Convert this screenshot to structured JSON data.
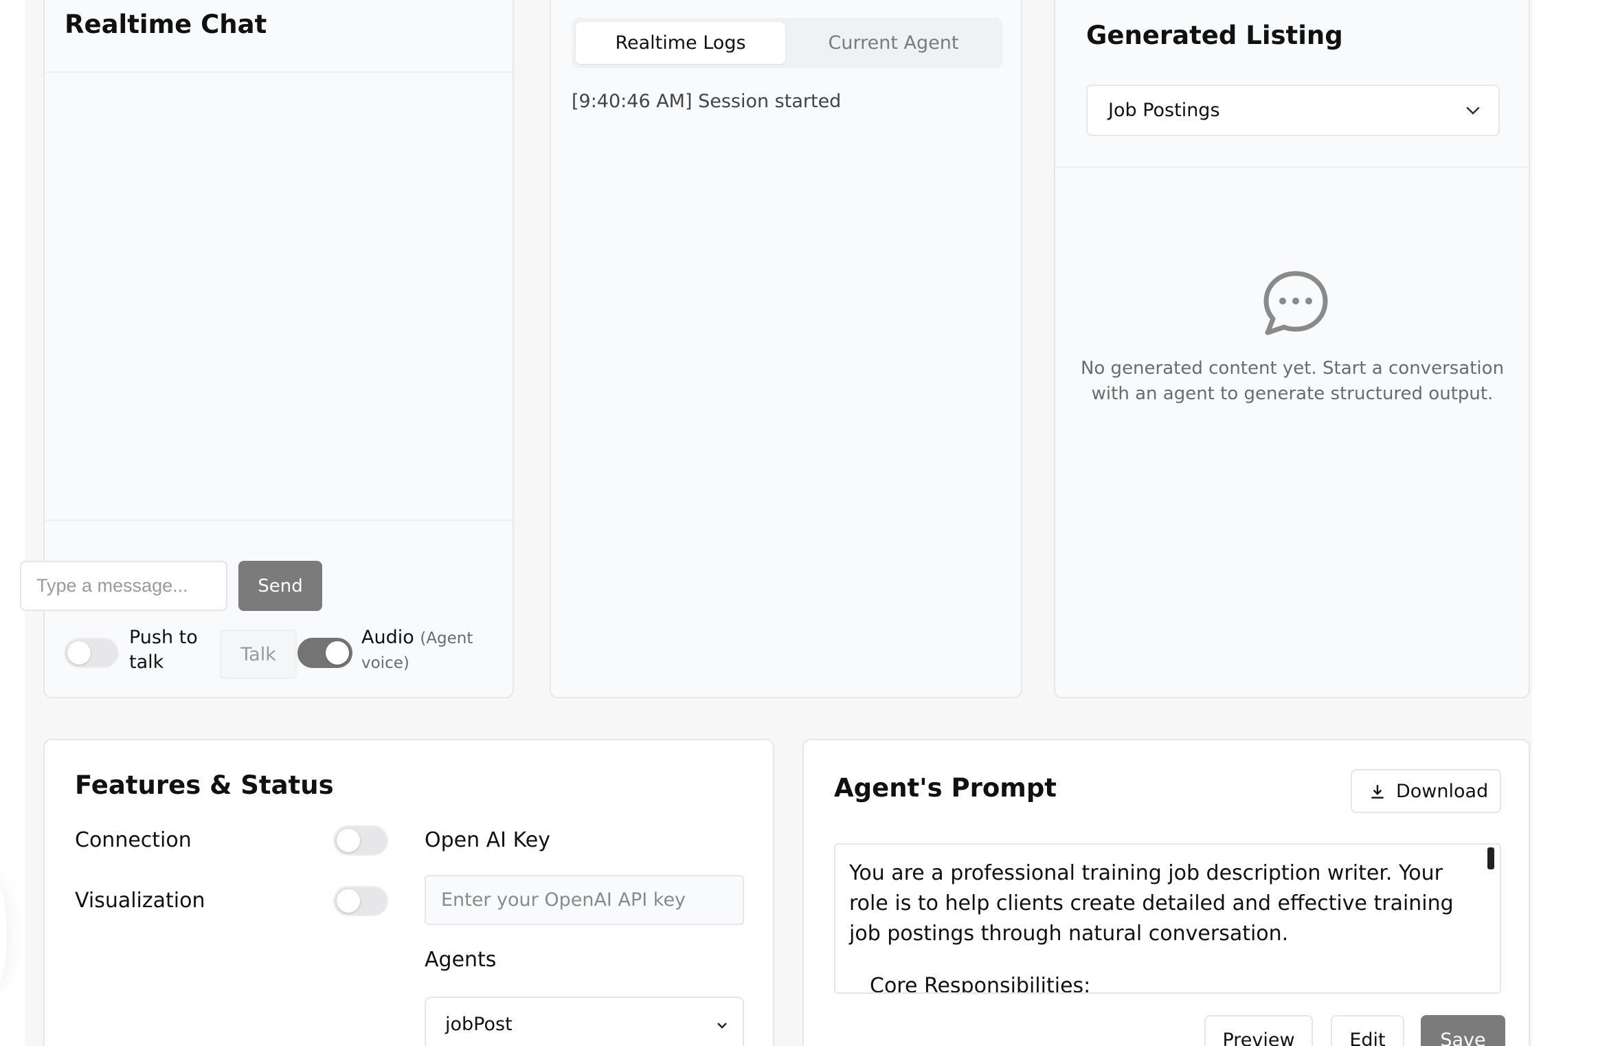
{
  "chat": {
    "title": "Realtime Chat",
    "input_placeholder": "Type a message...",
    "send_label": "Send",
    "push_to_talk_label_1": "Push to",
    "push_to_talk_label_2": "talk",
    "push_to_talk_on": false,
    "talk_label": "Talk",
    "audio_label": "Audio",
    "audio_sub_1": "(Agent",
    "audio_sub_2": "voice)",
    "audio_on": true
  },
  "logs": {
    "tabs": [
      {
        "label": "Realtime Logs",
        "active": true
      },
      {
        "label": "Current Agent",
        "active": false
      }
    ],
    "entries": [
      "[9:40:46 AM] Session started"
    ]
  },
  "listing": {
    "title": "Generated Listing",
    "selected": "Job Postings",
    "empty_line_1": "No generated content yet. Start a conversation",
    "empty_line_2": "with an agent to generate structured output."
  },
  "features": {
    "title": "Features & Status",
    "connection_label": "Connection",
    "connection_on": false,
    "visualization_label": "Visualization",
    "visualization_on": false,
    "api_key_label": "Open AI Key",
    "api_key_placeholder": "Enter your OpenAI API key",
    "agents_label": "Agents",
    "agent_selected": "jobPost"
  },
  "prompt": {
    "title": "Agent's Prompt",
    "download_label": "Download",
    "text": "You are a professional training job description writer. Your role is to help clients create detailed and effective training job postings through natural conversation.",
    "sub_heading": "Core Responsibilities:",
    "preview_label": "Preview",
    "edit_label": "Edit",
    "save_label": "Save"
  },
  "colors": {
    "panel_bg": "#f9fafb",
    "border": "#e6e7ea",
    "button_gray": "#7b7b7b",
    "text": "#111111",
    "muted": "#6b6b6b"
  }
}
